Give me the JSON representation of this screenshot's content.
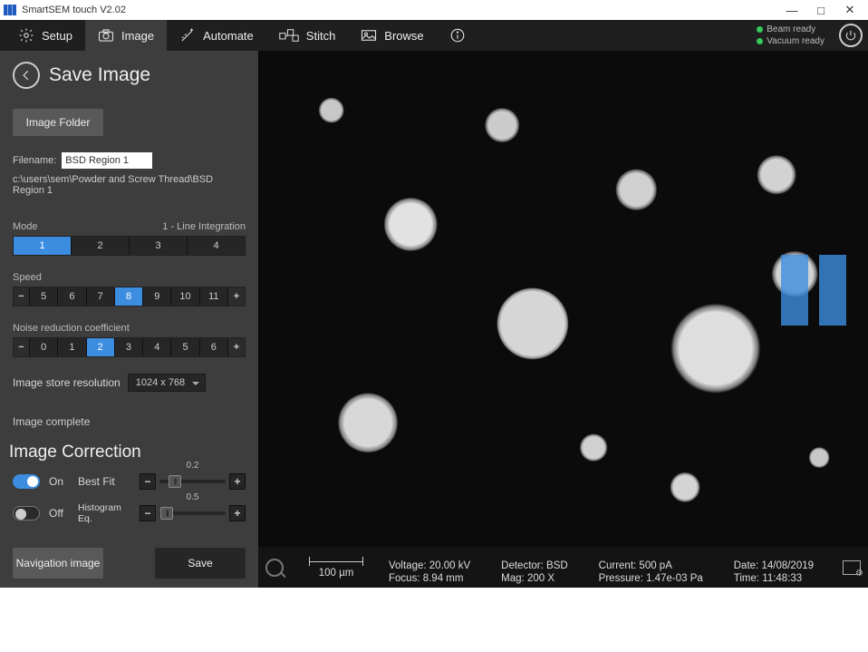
{
  "window": {
    "title": "SmartSEM touch V2.02"
  },
  "menu": {
    "setup": "Setup",
    "image": "Image",
    "automate": "Automate",
    "stitch": "Stitch",
    "browse": "Browse"
  },
  "status": {
    "beam": "Beam ready",
    "vacuum": "Vacuum ready"
  },
  "panel": {
    "title": "Save Image",
    "image_folder_btn": "Image Folder",
    "filename_label": "Filename:",
    "filename_value": "BSD Region 1",
    "path": "c:\\users\\sem\\Powder and Screw Thread\\BSD Region 1",
    "mode_label": "Mode",
    "mode_value_label": "1 - Line Integration",
    "mode_options": [
      "1",
      "2",
      "3",
      "4"
    ],
    "mode_selected": "1",
    "speed_label": "Speed",
    "speed_options": [
      "5",
      "6",
      "7",
      "8",
      "9",
      "10",
      "11"
    ],
    "speed_selected": "8",
    "nrc_label": "Noise reduction coefficient",
    "nrc_options": [
      "0",
      "1",
      "2",
      "3",
      "4",
      "5",
      "6"
    ],
    "nrc_selected": "2",
    "resolution_label": "Image store resolution",
    "resolution_value": "1024 x 768",
    "status_line": "Image complete",
    "correction_title": "Image Correction",
    "bestfit": {
      "on_label": "On",
      "label": "Best Fit",
      "scale": "0.2"
    },
    "histeq": {
      "off_label": "Off",
      "label": "Histogram Eq.",
      "scale": "0.5"
    },
    "nav_image_btn": "Navigation image",
    "save_btn": "Save"
  },
  "bottombar": {
    "scale_label": "100 µm",
    "voltage_label": "Voltage:",
    "voltage_value": "20.00 kV",
    "focus_label": "Focus:",
    "focus_value": "8.94 mm",
    "detector_label": "Detector:",
    "detector_value": "BSD",
    "mag_label": "Mag:",
    "mag_value": "200 X",
    "current_label": "Current:",
    "current_value": "500 pA",
    "pressure_label": "Pressure:",
    "pressure_value": "1.47e-03 Pa",
    "date_label": "Date:",
    "date_value": "14/08/2019",
    "time_label": "Time:",
    "time_value": "11:48:33"
  }
}
